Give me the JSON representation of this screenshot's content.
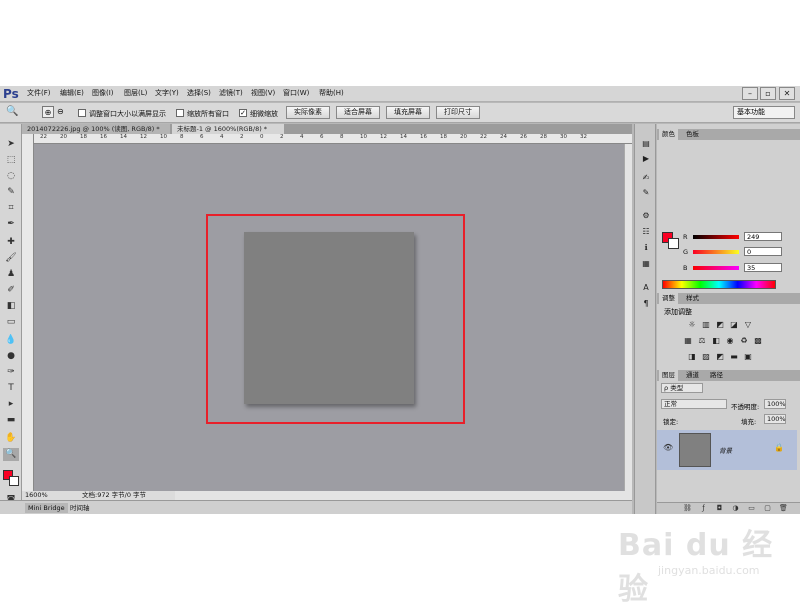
{
  "app": {
    "logo": "Ps"
  },
  "menu": [
    "文件(F)",
    "编辑(E)",
    "图像(I)",
    "图层(L)",
    "文字(Y)",
    "选择(S)",
    "滤镜(T)",
    "视图(V)",
    "窗口(W)",
    "帮助(H)"
  ],
  "window_buttons": [
    "–",
    "▫",
    "✕"
  ],
  "options": {
    "resize_windows_label": "调整窗口大小以满屏显示",
    "zoom_all_label": "缩放所有窗口",
    "scrubby_zoom_label": "细微缩放",
    "scrubby_checked": true,
    "buttons": [
      "实际像素",
      "适合屏幕",
      "填充屏幕",
      "打印尺寸"
    ],
    "workspace": "基本功能"
  },
  "tabs": [
    {
      "label": "2014072226.jpg @ 100% (读图, RGB/8) *",
      "active": false
    },
    {
      "label": "未标题-1 @ 1600%(RGB/8) *",
      "active": true
    }
  ],
  "ruler_ticks": [
    "22",
    "20",
    "18",
    "16",
    "14",
    "12",
    "10",
    "8",
    "6",
    "4",
    "2",
    "0",
    "2",
    "4",
    "6",
    "8",
    "10",
    "12",
    "14",
    "16",
    "18",
    "20",
    "22",
    "24",
    "26",
    "28",
    "30",
    "32"
  ],
  "status": {
    "zoom": "1600%",
    "doc": "文档:972 字节/0 字节"
  },
  "bottom_tabs": [
    "Mini Bridge",
    "时间轴"
  ],
  "color_panel": {
    "tabs": [
      "颜色",
      "色板"
    ],
    "r_label": "R",
    "g_label": "G",
    "b_label": "B",
    "r": "249",
    "g": "0",
    "b": "35",
    "fg": "#f90023",
    "bg": "#ffffff"
  },
  "adjustments_panel": {
    "tabs": [
      "调整",
      "样式"
    ],
    "title": "添加调整"
  },
  "layers_panel": {
    "tabs": [
      "图层",
      "通道",
      "路径"
    ],
    "filter": "ρ 类型",
    "blend": "正常",
    "opacity_label": "不透明度:",
    "opacity": "100%",
    "lock_label": "锁定:",
    "fill_label": "填充:",
    "fill": "100%",
    "layer_name": "背景"
  },
  "watermark": {
    "text": "Bai du 经验",
    "sub": "jingyan.baidu.com"
  }
}
